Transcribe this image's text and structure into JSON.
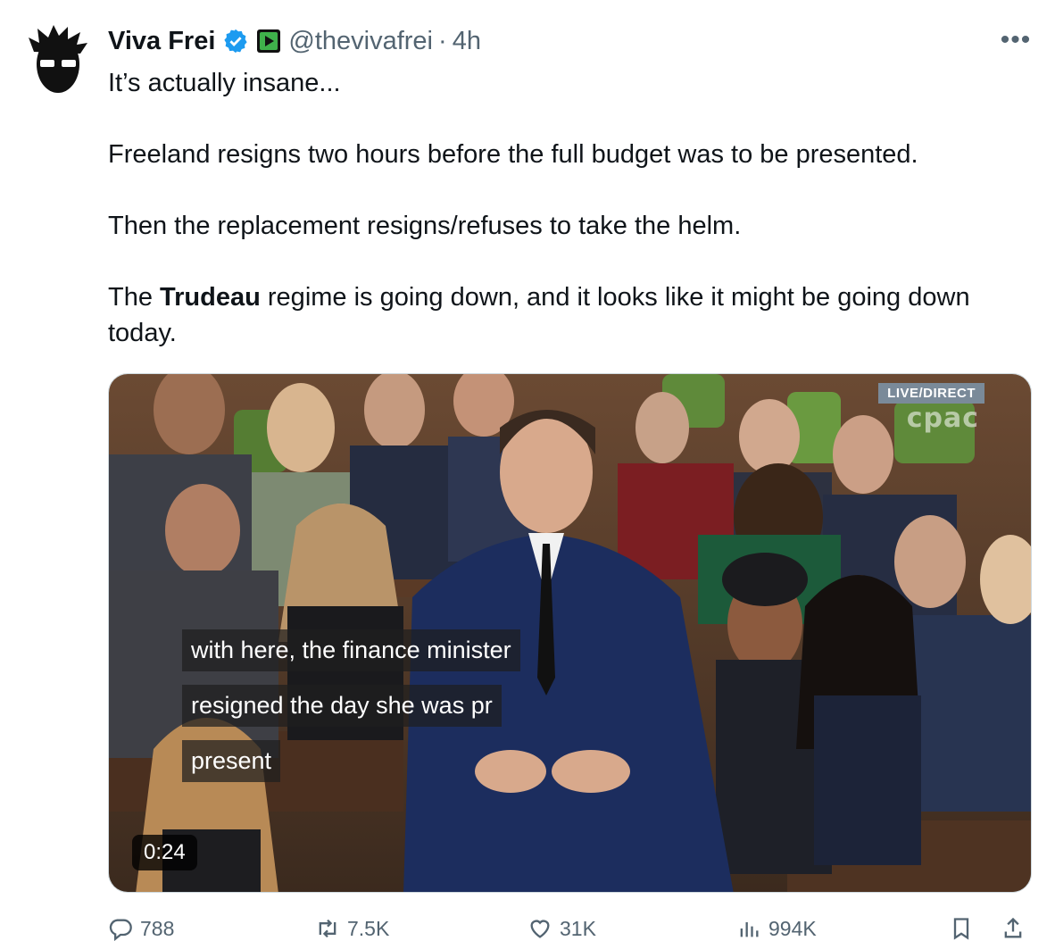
{
  "author": {
    "name": "Viva Frei",
    "handle": "@thevivafrei",
    "separator": "·",
    "time": "4h"
  },
  "more_label": "•••",
  "tweet": {
    "line1": "It’s actually insane...",
    "line2": "Freeland resigns two hours before the full budget was to be presented.",
    "line3": "Then the replacement resigns/refuses to take the helm.",
    "line4_pre": "The ",
    "line4_bold": "Trudeau",
    "line4_post": " regime is going down, and it looks like it might be going down today."
  },
  "video": {
    "live_badge": "LIVE/DIRECT",
    "watermark": "cpac",
    "captions": [
      "with here, the finance minister",
      "resigned the day she was pr",
      "present"
    ],
    "duration": "0:24"
  },
  "actions": {
    "replies": "788",
    "retweets": "7.5K",
    "likes": "31K",
    "views": "994K"
  },
  "colors": {
    "verified": "#1d9bf0",
    "secondary_text": "#536471",
    "chamber_green": "#5f8a3a"
  },
  "icons": [
    "verified-badge-icon",
    "subscription-badge-icon",
    "more-icon",
    "reply-icon",
    "retweet-icon",
    "like-icon",
    "views-icon",
    "bookmark-icon",
    "share-icon"
  ]
}
